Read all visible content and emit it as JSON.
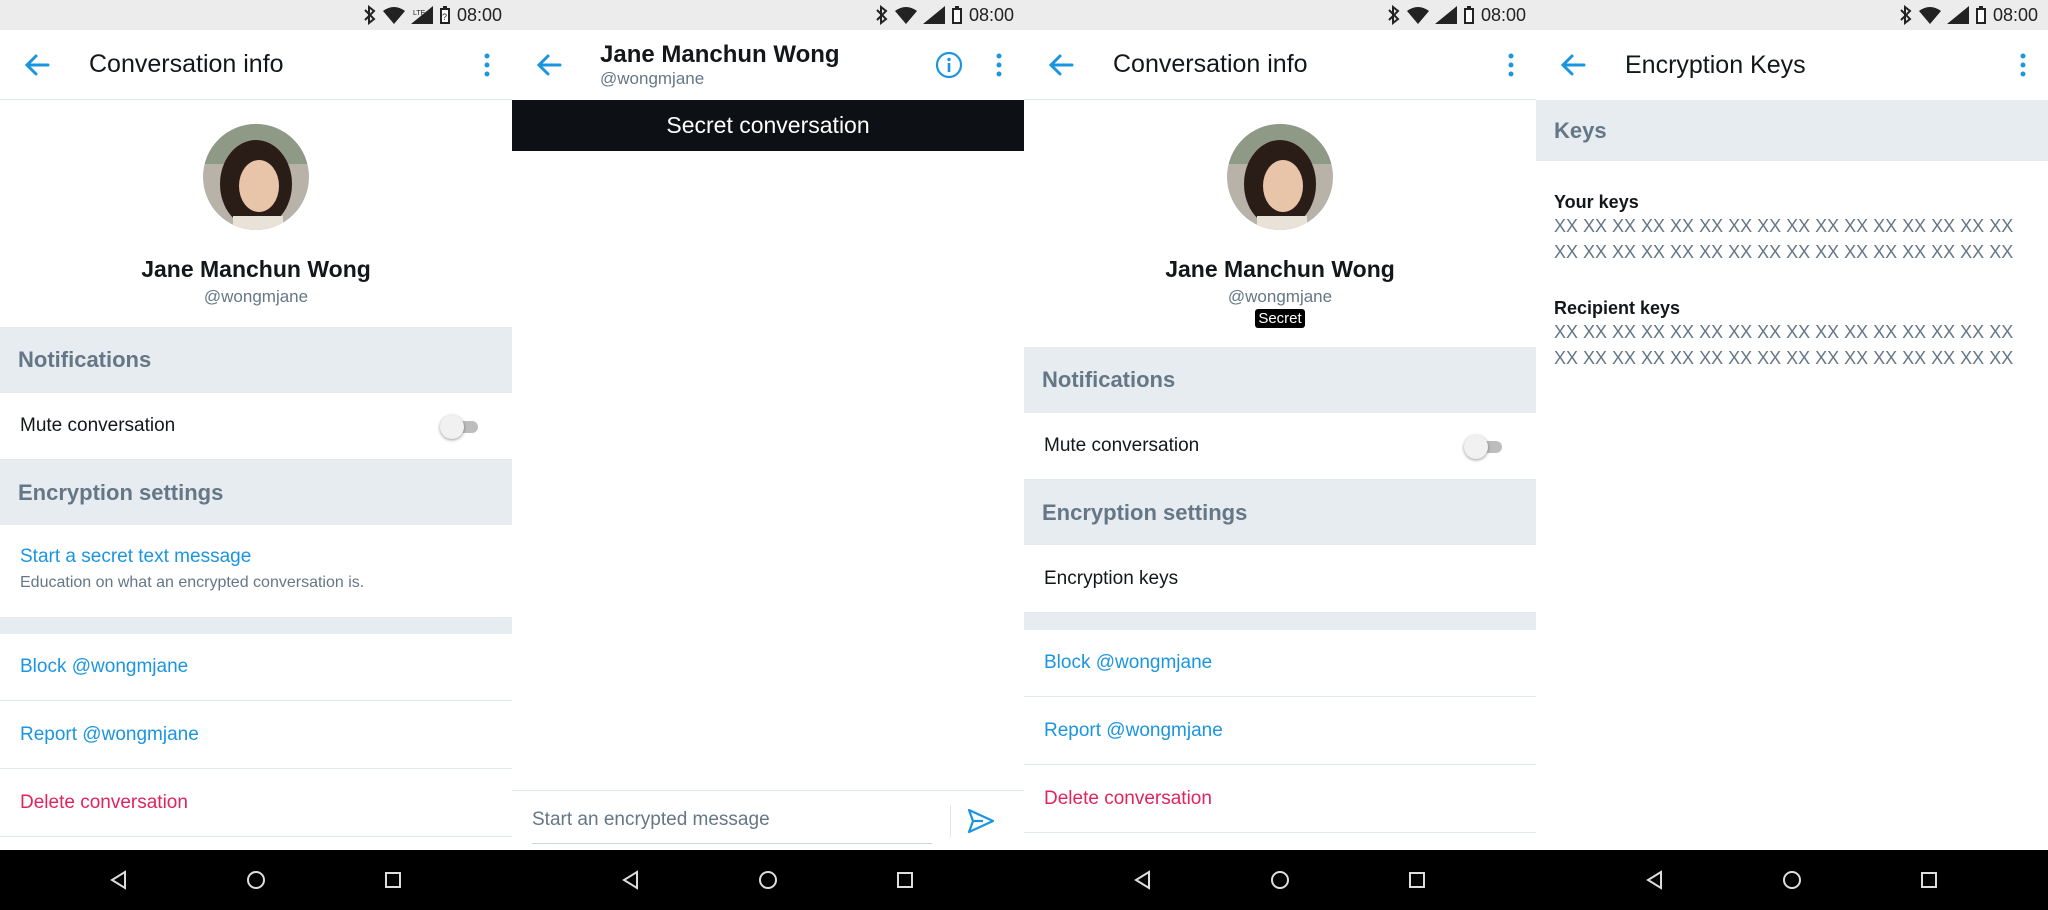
{
  "status_bar": {
    "time": "08:00"
  },
  "colors": {
    "accent": "#1b95e0",
    "danger": "#e0245e",
    "section_bg": "#e6ecf0",
    "secondary_text": "#657786"
  },
  "screen1": {
    "title": "Conversation info",
    "profile": {
      "name": "Jane Manchun Wong",
      "handle": "@wongmjane"
    },
    "sections": {
      "notifications": "Notifications",
      "encryption": "Encryption settings"
    },
    "mute_label": "Mute conversation",
    "mute_enabled": false,
    "secret_message": {
      "title": "Start a secret text message",
      "subtitle": "Education on what an encrypted conversation is."
    },
    "block": "Block @wongmjane",
    "report": "Report @wongmjane",
    "delete": "Delete conversation"
  },
  "screen2": {
    "name": "Jane Manchun Wong",
    "handle": "@wongmjane",
    "banner": "Secret conversation",
    "composer_placeholder": "Start an encrypted message"
  },
  "screen3": {
    "title": "Conversation info",
    "profile": {
      "name": "Jane Manchun Wong",
      "handle": "@wongmjane",
      "badge": "Secret"
    },
    "sections": {
      "notifications": "Notifications",
      "encryption": "Encryption settings"
    },
    "mute_label": "Mute conversation",
    "mute_enabled": false,
    "encryption_keys": "Encryption keys",
    "block": "Block @wongmjane",
    "report": "Report @wongmjane",
    "delete": "Delete conversation"
  },
  "screen4": {
    "title": "Encryption Keys",
    "section": "Keys",
    "your_keys": {
      "title": "Your keys",
      "line1": "XX XX XX XX XX XX XX XX XX XX XX XX XX XX XX XX",
      "line2": "XX XX XX XX XX XX XX XX XX XX XX XX XX XX XX XX"
    },
    "recipient_keys": {
      "title": "Recipient keys",
      "line1": "XX XX XX XX XX XX XX XX XX XX XX XX XX XX XX XX",
      "line2": "XX XX XX XX XX XX XX XX XX XX XX XX XX XX XX XX"
    }
  }
}
